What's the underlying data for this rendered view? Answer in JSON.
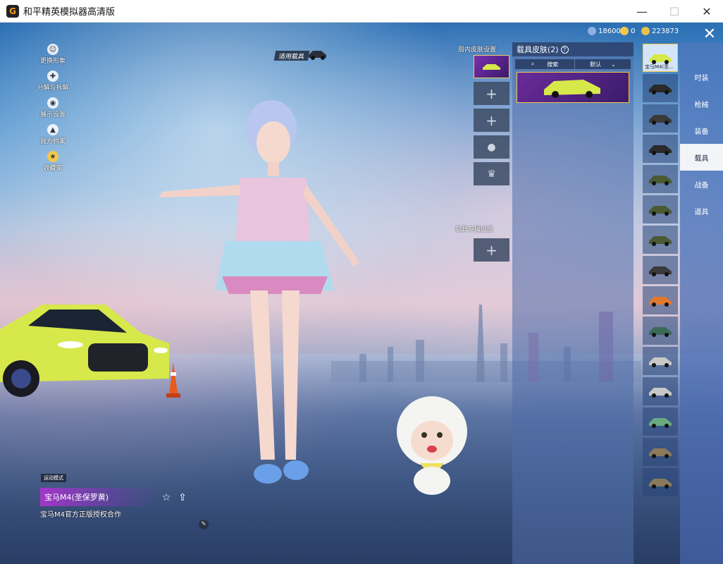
{
  "window": {
    "title": "和平精英模拟器高清版",
    "logo_glyph": "G",
    "minimize": "—",
    "maximize": "☐",
    "close": "✕"
  },
  "currency": [
    {
      "value": "18600",
      "color": "#8fb0e0"
    },
    {
      "value": "0",
      "color": "#f2c84b"
    },
    {
      "value": "223873",
      "color": "#e8c04a"
    }
  ],
  "close_icon": "✕",
  "side_menu": [
    {
      "label": "更换形象",
      "icon": "person-icon"
    },
    {
      "label": "分解与拆解",
      "icon": "puzzle-icon"
    },
    {
      "label": "展示设置",
      "icon": "eye-icon"
    },
    {
      "label": "我方档案",
      "icon": "flame-icon"
    },
    {
      "label": "收藏家",
      "icon": "badge-icon"
    }
  ],
  "equip_tag": "适用载具",
  "slot_section": {
    "title": "局内皮肤设置",
    "plus": "+",
    "slots": [
      "filled",
      "plus",
      "plus",
      "mic-icon",
      "crown-icon"
    ],
    "second_title": "载具专属皮肤",
    "second_slot": "+"
  },
  "skin_panel": {
    "title": "载具皮肤(2)",
    "help": "?",
    "search_label": "搜索",
    "sort_label": "默认",
    "card_color": "#d7e84a"
  },
  "categories": [
    {
      "label": "时装",
      "active": false
    },
    {
      "label": "枪械",
      "active": false
    },
    {
      "label": "装备",
      "active": false
    },
    {
      "label": "载具",
      "active": true
    },
    {
      "label": "战备",
      "active": false
    },
    {
      "label": "道具",
      "active": false
    }
  ],
  "vehicles": [
    {
      "name": "宝马M4(圣...",
      "selected": true,
      "color": "#d7e84a"
    },
    {
      "name": "",
      "selected": false,
      "color": "#2a2a2a"
    },
    {
      "name": "",
      "selected": false,
      "color": "#3a3a3a"
    },
    {
      "name": "",
      "selected": false,
      "color": "#2a2a2a"
    },
    {
      "name": "",
      "selected": false,
      "color": "#4a5a32"
    },
    {
      "name": "",
      "selected": false,
      "color": "#4a5a32"
    },
    {
      "name": "",
      "selected": false,
      "color": "#4a5a32"
    },
    {
      "name": "",
      "selected": false,
      "color": "#3a3a3a"
    },
    {
      "name": "",
      "selected": false,
      "color": "#e07830"
    },
    {
      "name": "",
      "selected": false,
      "color": "#3a6a5a"
    },
    {
      "name": "",
      "selected": false,
      "color": "#c8c8c8"
    },
    {
      "name": "",
      "selected": false,
      "color": "#c8c8c8"
    },
    {
      "name": "",
      "selected": false,
      "color": "#6aa880"
    },
    {
      "name": "",
      "selected": false,
      "color": "#8a7a5a"
    },
    {
      "name": "",
      "selected": false,
      "color": "#8a7a5a"
    }
  ],
  "vehicle_info": {
    "mode_tag": "运动模式",
    "name": "宝马M4(圣保罗黄)",
    "description": "宝马M4官方正版授权合作",
    "star_icon": "☆",
    "share_icon": "⇪",
    "tool_icon": "✎"
  }
}
